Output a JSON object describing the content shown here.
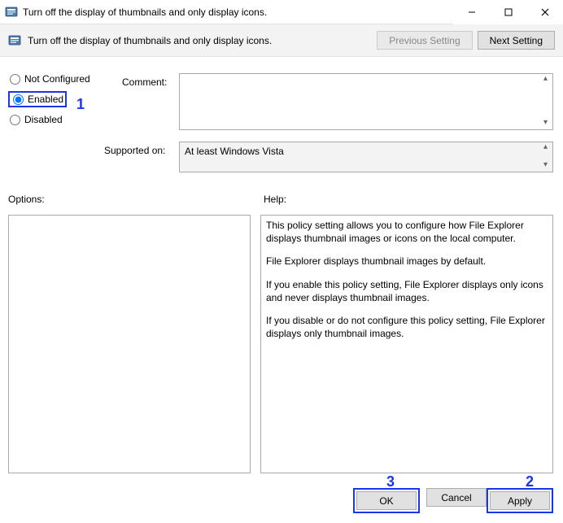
{
  "window": {
    "title": "Turn off the display of thumbnails and only display icons.",
    "subtitle": "Turn off the display of thumbnails and only display icons."
  },
  "nav": {
    "previous_label": "Previous Setting",
    "next_label": "Next Setting"
  },
  "radios": {
    "not_configured": "Not Configured",
    "enabled": "Enabled",
    "disabled": "Disabled"
  },
  "labels": {
    "comment": "Comment:",
    "supported": "Supported on:",
    "options": "Options:",
    "help": "Help:"
  },
  "fields": {
    "comment_value": "",
    "supported_value": "At least Windows Vista"
  },
  "help": {
    "p1": "This policy setting allows you to configure how File Explorer displays thumbnail images or icons on the local computer.",
    "p2": "File Explorer displays thumbnail images by default.",
    "p3": "If you enable this policy setting, File Explorer displays only icons and never displays thumbnail images.",
    "p4": "If you disable or do not configure this policy setting, File Explorer displays only thumbnail images."
  },
  "buttons": {
    "ok": "OK",
    "cancel": "Cancel",
    "apply": "Apply"
  },
  "annotations": {
    "n1": "1",
    "n2": "2",
    "n3": "3"
  }
}
